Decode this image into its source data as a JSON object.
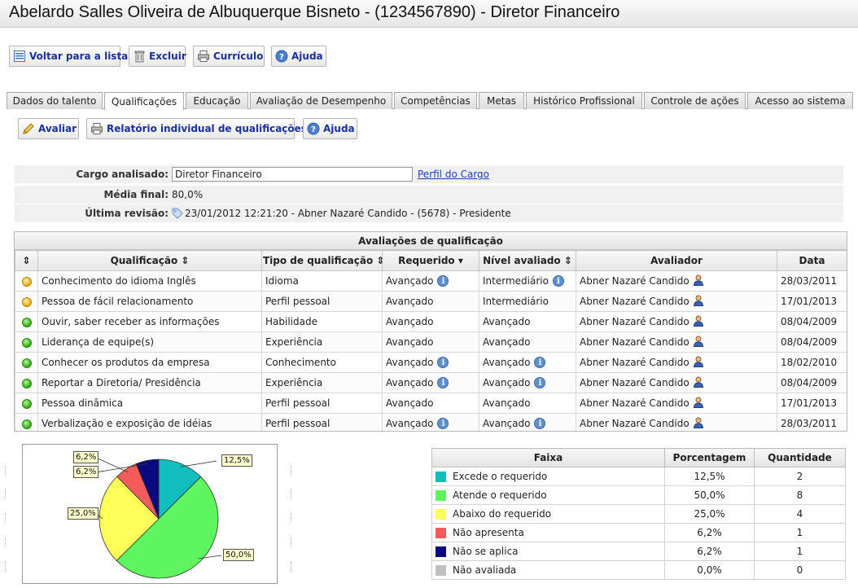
{
  "header": {
    "title": "Abelardo Salles Oliveira de Albuquerque Bisneto - (1234567890) - Diretor Financeiro"
  },
  "top_toolbar": {
    "back_label": "Voltar para a lista",
    "delete_label": "Excluir",
    "resume_label": "Currículo",
    "help_label": "Ajuda"
  },
  "tabs": [
    "Dados do talento",
    "Qualificações",
    "Educação",
    "Avaliação de Desempenho",
    "Competências",
    "Metas",
    "Histórico Profissional",
    "Controle de ações",
    "Acesso ao sistema"
  ],
  "sub_toolbar": {
    "evaluate_label": "Avaliar",
    "report_label": "Relatório individual de qualificações",
    "help_label": "Ajuda"
  },
  "summary": {
    "cargo_label": "Cargo analisado:",
    "cargo_value": "Diretor Financeiro",
    "cargo_link": "Perfil do Cargo",
    "media_label": "Média final:",
    "media_value": "80,0%",
    "revisao_label": "Última revisão:",
    "revisao_value": "23/01/2012 12:21:20 - Abner Nazaré Candido - (5678) - Presidente"
  },
  "grid": {
    "caption": "Avaliações de qualificação",
    "headers": {
      "sort": "⇕",
      "qualificacao": "Qualificação ⇕",
      "tipo": "Tipo de qualificação ⇕",
      "requerido": "Requerido ▾",
      "nivel": "Nível avaliado ⇕",
      "avaliador": "Avaliador",
      "data": "Data"
    },
    "rows": [
      {
        "status": "amber",
        "q": "Conhecimento do idioma Inglês",
        "tipo": "Idioma",
        "req": "Avançado",
        "req_info": true,
        "nivel": "Intermediário",
        "nivel_info": true,
        "aval": "Abner Nazaré Candido",
        "data": "28/03/2011"
      },
      {
        "status": "amber",
        "q": "Pessoa de fácil relacionamento",
        "tipo": "Perfil pessoal",
        "req": "Avançado",
        "req_info": false,
        "nivel": "Intermediário",
        "nivel_info": false,
        "aval": "Abner Nazaré Candido",
        "data": "17/01/2013"
      },
      {
        "status": "green",
        "q": "Ouvir, saber receber as informações",
        "tipo": "Habilidade",
        "req": "Avançado",
        "req_info": false,
        "nivel": "Avançado",
        "nivel_info": false,
        "aval": "Abner Nazaré Candido",
        "data": "08/04/2009"
      },
      {
        "status": "green",
        "q": "Liderança de equipe(s)",
        "tipo": "Experiência",
        "req": "Avançado",
        "req_info": false,
        "nivel": "Avançado",
        "nivel_info": false,
        "aval": "Abner Nazaré Candido",
        "data": "08/04/2009"
      },
      {
        "status": "green",
        "q": "Conhecer os produtos da empresa",
        "tipo": "Conhecimento",
        "req": "Avançado",
        "req_info": true,
        "nivel": "Avançado",
        "nivel_info": true,
        "aval": "Abner Nazaré Candido",
        "data": "18/02/2010"
      },
      {
        "status": "green",
        "q": "Reportar a Diretoria/ Presidência",
        "tipo": "Experiência",
        "req": "Avançado",
        "req_info": true,
        "nivel": "Avançado",
        "nivel_info": true,
        "aval": "Abner Nazaré Candido",
        "data": "08/04/2009"
      },
      {
        "status": "green",
        "q": "Pessoa dinâmica",
        "tipo": "Perfil pessoal",
        "req": "Avançado",
        "req_info": false,
        "nivel": "Avançado",
        "nivel_info": false,
        "aval": "Abner Nazaré Candido",
        "data": "17/01/2013"
      },
      {
        "status": "green",
        "q": "Verbalização e exposição de idéias",
        "tipo": "Perfil pessoal",
        "req": "Avançado",
        "req_info": true,
        "nivel": "Avançado",
        "nivel_info": true,
        "aval": "Abner Nazaré Candido",
        "data": "28/03/2011"
      }
    ]
  },
  "chart_data": {
    "type": "pie",
    "title": "",
    "categories": [
      "Excede o requerido",
      "Atende o requerido",
      "Abaixo do requerido",
      "Não apresenta",
      "Não se aplica",
      "Não avaliada"
    ],
    "values": [
      12.5,
      50.0,
      25.0,
      6.2,
      6.2,
      0.0
    ],
    "labels": [
      "12,5%",
      "50,0%",
      "25,0%",
      "6,2%",
      "6,2%",
      "0,0%"
    ],
    "colors": [
      "#12bdbd",
      "#5ef55e",
      "#ffff5a",
      "#f45c5c",
      "#0a0a80",
      "#c0c0c0"
    ]
  },
  "legend": {
    "headers": {
      "faixa": "Faixa",
      "porcentagem": "Porcentagem",
      "quantidade": "Quantidade"
    },
    "rows": [
      {
        "faixa": "Excede o requerido",
        "pct": "12,5%",
        "qtd": "2",
        "color": "#12bdbd"
      },
      {
        "faixa": "Atende o requerido",
        "pct": "50,0%",
        "qtd": "8",
        "color": "#5ef55e"
      },
      {
        "faixa": "Abaixo do requerido",
        "pct": "25,0%",
        "qtd": "4",
        "color": "#ffff5a"
      },
      {
        "faixa": "Não apresenta",
        "pct": "6,2%",
        "qtd": "1",
        "color": "#f45c5c"
      },
      {
        "faixa": "Não se aplica",
        "pct": "6,2%",
        "qtd": "1",
        "color": "#0a0a80"
      },
      {
        "faixa": "Não avaliada",
        "pct": "0,0%",
        "qtd": "0",
        "color": "#c0c0c0"
      }
    ]
  }
}
